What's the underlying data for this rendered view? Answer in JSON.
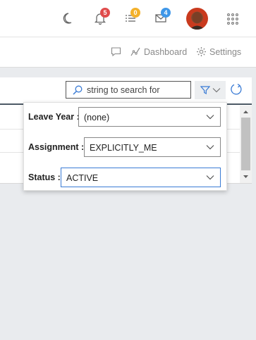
{
  "topbar": {
    "icons": [
      {
        "name": "dark-mode-moon-icon"
      },
      {
        "name": "notifications-bell-icon",
        "badge": "5",
        "badge_color": "#e04b4b"
      },
      {
        "name": "tasks-list-icon",
        "badge": "0",
        "badge_color": "#f3b12b"
      },
      {
        "name": "messages-envelope-icon",
        "badge": "4",
        "badge_color": "#3f97e8"
      },
      {
        "name": "apps-grid-icon"
      }
    ],
    "avatar": "user-avatar"
  },
  "subbar": {
    "chat_icon": "chat-bubble-icon",
    "dashboard_label": "Dashboard",
    "settings_label": "Settings"
  },
  "toolbar": {
    "search_placeholder": "string to search for",
    "filter_icon": "filter-funnel-icon",
    "refresh_icon": "refresh-icon"
  },
  "filters": [
    {
      "label": "Leave Year :",
      "value": "(none)"
    },
    {
      "label": "Assignment :",
      "value": "EXPLICITLY_ME"
    },
    {
      "label": "Status :",
      "value": "ACTIVE"
    }
  ],
  "colors": {
    "accent": "#3a7bd5",
    "header_rule": "#4d5a66"
  }
}
